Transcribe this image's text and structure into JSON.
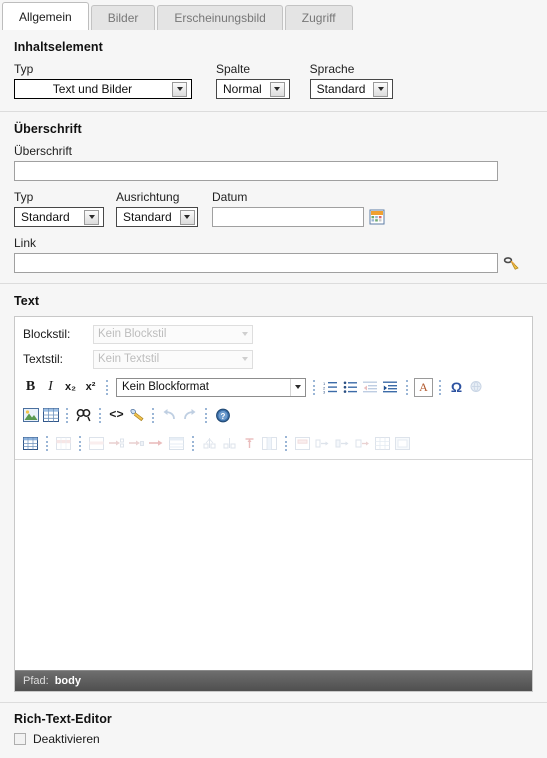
{
  "tabs": [
    {
      "label": "Allgemein",
      "active": true
    },
    {
      "label": "Bilder",
      "active": false
    },
    {
      "label": "Erscheinungsbild",
      "active": false
    },
    {
      "label": "Zugriff",
      "active": false
    }
  ],
  "content_element": {
    "heading": "Inhaltselement",
    "type": {
      "label": "Typ",
      "value": "Text und Bilder"
    },
    "column": {
      "label": "Spalte",
      "value": "Normal"
    },
    "language": {
      "label": "Sprache",
      "value": "Standard"
    }
  },
  "headline": {
    "heading": "Überschrift",
    "text": {
      "label": "Überschrift",
      "value": "",
      "placeholder": ""
    },
    "type": {
      "label": "Typ",
      "value": "Standard"
    },
    "alignment": {
      "label": "Ausrichtung",
      "value": "Standard"
    },
    "date": {
      "label": "Datum",
      "value": "",
      "placeholder": "",
      "picker_icon": "calendar-icon"
    },
    "link": {
      "label": "Link",
      "value": "",
      "placeholder": "",
      "picker_icon": "link-wizard-icon"
    }
  },
  "text": {
    "heading": "Text",
    "block_style": {
      "label": "Blockstil:",
      "value": "Kein Blockstil",
      "disabled": true
    },
    "text_style": {
      "label": "Textstil:",
      "value": "Kein Textstil",
      "disabled": true
    },
    "block_format": {
      "value": "Kein Blockformat"
    },
    "toolbar_row1": [
      {
        "name": "bold-icon",
        "glyph": "B",
        "enabled": true
      },
      {
        "name": "italic-icon",
        "glyph": "I",
        "enabled": true
      },
      {
        "name": "subscript-icon",
        "glyph": "x₂",
        "enabled": true
      },
      {
        "name": "superscript-icon",
        "glyph": "x²",
        "enabled": true
      },
      {
        "name": "ordered-list-icon",
        "glyph": "",
        "enabled": true
      },
      {
        "name": "unordered-list-icon",
        "glyph": "",
        "enabled": true
      },
      {
        "name": "outdent-icon",
        "glyph": "",
        "enabled": false
      },
      {
        "name": "indent-icon",
        "glyph": "",
        "enabled": true
      },
      {
        "name": "text-color-icon",
        "glyph": "A",
        "enabled": true
      },
      {
        "name": "special-character-icon",
        "glyph": "Ω",
        "enabled": true
      },
      {
        "name": "spellcheck-icon",
        "glyph": "",
        "enabled": false
      }
    ],
    "toolbar_row2": [
      {
        "name": "insert-image-icon",
        "enabled": true
      },
      {
        "name": "insert-table-icon",
        "enabled": true
      },
      {
        "name": "find-replace-icon",
        "enabled": true
      },
      {
        "name": "source-code-icon",
        "enabled": true
      },
      {
        "name": "clean-html-icon",
        "enabled": true
      },
      {
        "name": "undo-icon",
        "enabled": false
      },
      {
        "name": "redo-icon",
        "enabled": false
      },
      {
        "name": "help-icon",
        "enabled": true
      }
    ],
    "toolbar_row3": [
      {
        "name": "table-properties-icon",
        "enabled": true
      },
      {
        "name": "row-properties-icon",
        "enabled": false
      },
      {
        "name": "insert-row-icon",
        "enabled": false
      },
      {
        "name": "insert-row-above-icon",
        "enabled": false
      },
      {
        "name": "insert-row-below-icon",
        "enabled": false
      },
      {
        "name": "delete-row-icon",
        "enabled": false
      },
      {
        "name": "merge-cells-icon",
        "enabled": false
      },
      {
        "name": "split-row-icon",
        "enabled": false
      },
      {
        "name": "split-column-icon",
        "enabled": false
      },
      {
        "name": "delete-column-icon",
        "enabled": false
      },
      {
        "name": "column-properties-icon",
        "enabled": false
      },
      {
        "name": "cell-properties-icon",
        "enabled": false
      },
      {
        "name": "insert-column-left-icon",
        "enabled": false
      },
      {
        "name": "insert-column-right-icon",
        "enabled": false
      },
      {
        "name": "split-cell-icon",
        "enabled": false
      },
      {
        "name": "table-grid-icon",
        "enabled": false
      },
      {
        "name": "table-frame-icon",
        "enabled": false
      }
    ],
    "editor_content": "",
    "path": {
      "label": "Pfad:",
      "value": "body"
    }
  },
  "rich_text_editor": {
    "heading": "Rich-Text-Editor",
    "disable": {
      "label": "Deaktivieren",
      "checked": false
    }
  },
  "colors": {
    "page_bg": "#f6f6f6",
    "panel_bg": "#f6f6f6",
    "active_tab_bg": "#ffffff",
    "inactive_tab_bg": "#e4e4e4",
    "path_bar_bg": "#5e5e5e",
    "separator_dots": "#9bb6d6"
  }
}
